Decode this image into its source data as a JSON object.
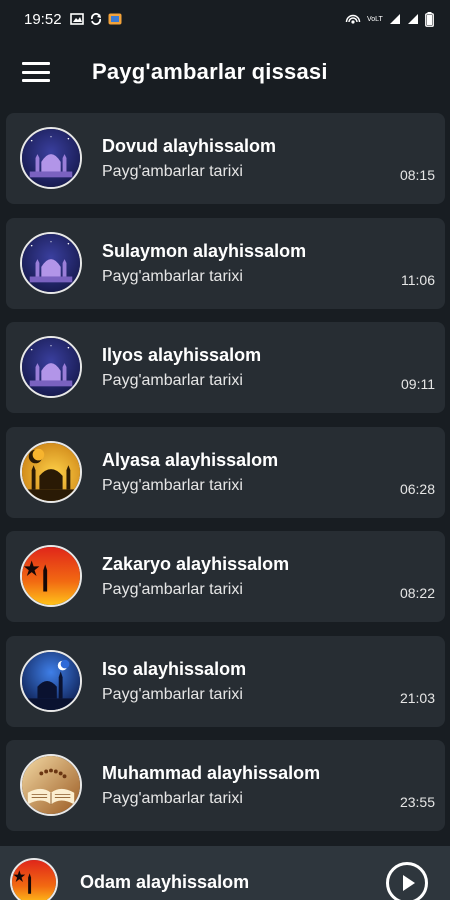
{
  "status_bar": {
    "time": "19:52",
    "right_label": "VoLTE"
  },
  "app_bar": {
    "title": "Payg'ambarlar qissasi"
  },
  "items": [
    {
      "title": "Dovud alayhissalom",
      "subtitle": "Payg'ambarlar tarixi",
      "duration": "08:15",
      "image": "mosque-night-purple"
    },
    {
      "title": "Sulaymon alayhissalom",
      "subtitle": "Payg'ambarlar tarixi",
      "duration": "11:06",
      "image": "mosque-night-purple"
    },
    {
      "title": "Ilyos alayhissalom",
      "subtitle": "Payg'ambarlar tarixi",
      "duration": "09:11",
      "image": "mosque-night-purple"
    },
    {
      "title": "Alyasa alayhissalom",
      "subtitle": "Payg'ambarlar tarixi",
      "duration": "06:28",
      "image": "mosque-golden"
    },
    {
      "title": "Zakaryo alayhissalom",
      "subtitle": "Payg'ambarlar tarixi",
      "duration": "08:22",
      "image": "crescent-red-sunset"
    },
    {
      "title": "Iso alayhissalom",
      "subtitle": "Payg'ambarlar tarixi",
      "duration": "21:03",
      "image": "mosque-blue-night"
    },
    {
      "title": "Muhammad alayhissalom",
      "subtitle": "Payg'ambarlar tarixi",
      "duration": "23:55",
      "image": "quran-book"
    }
  ],
  "player": {
    "title": "Odam alayhissalom",
    "image": "crescent-red-sunset",
    "play_icon": "play-icon"
  },
  "colors": {
    "background": "#181d22",
    "card": "#272d33",
    "player_bar": "#2e363d",
    "text_primary": "#ffffff",
    "text_secondary": "#e6e6e6"
  }
}
